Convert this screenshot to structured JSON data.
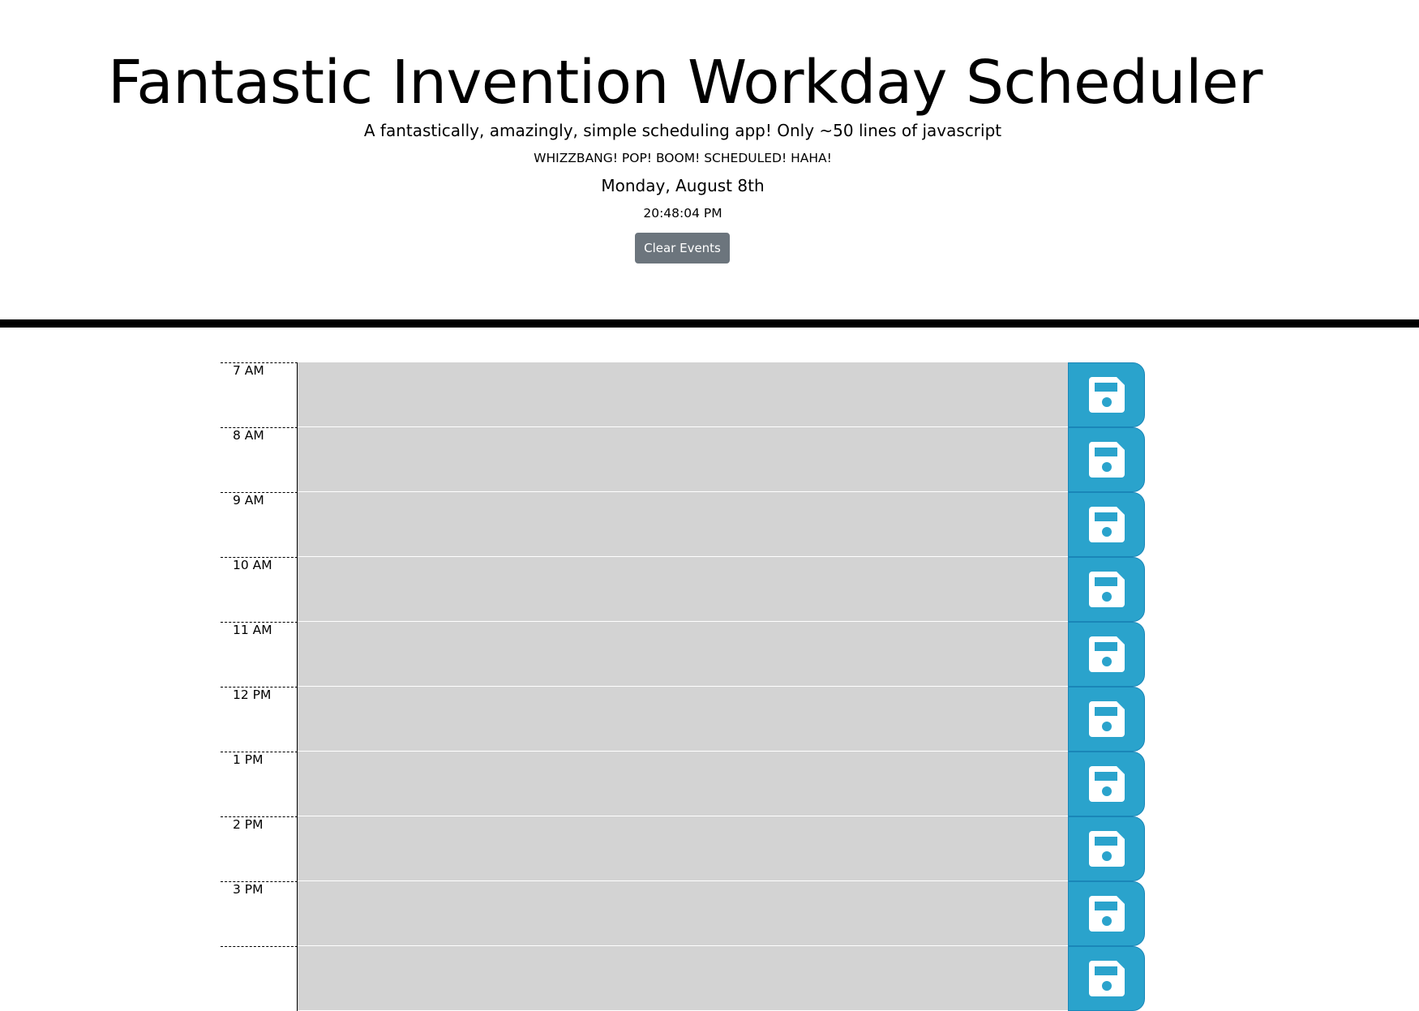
{
  "header": {
    "title": "Fantastic Invention Workday Scheduler",
    "lead": "A fantastically, amazingly, simple scheduling app! Only ~50 lines of javascript",
    "tagline": "WHIZZBANG! POP! BOOM! SCHEDULED! HAHA!",
    "date": "Monday, August 8th",
    "time": "20:48:04 PM",
    "clear_label": "Clear Events"
  },
  "schedule": {
    "rows": [
      {
        "hour": "7 AM",
        "text": ""
      },
      {
        "hour": "8 AM",
        "text": ""
      },
      {
        "hour": "9 AM",
        "text": ""
      },
      {
        "hour": "10 AM",
        "text": ""
      },
      {
        "hour": "11 AM",
        "text": ""
      },
      {
        "hour": "12 PM",
        "text": ""
      },
      {
        "hour": "1 PM",
        "text": ""
      },
      {
        "hour": "2 PM",
        "text": ""
      },
      {
        "hour": "3 PM",
        "text": ""
      }
    ],
    "save_icon": "save-icon"
  },
  "colors": {
    "past_row": "#d3d3d3",
    "save_button": "#2aa3cc",
    "clear_button": "#6c757d"
  }
}
